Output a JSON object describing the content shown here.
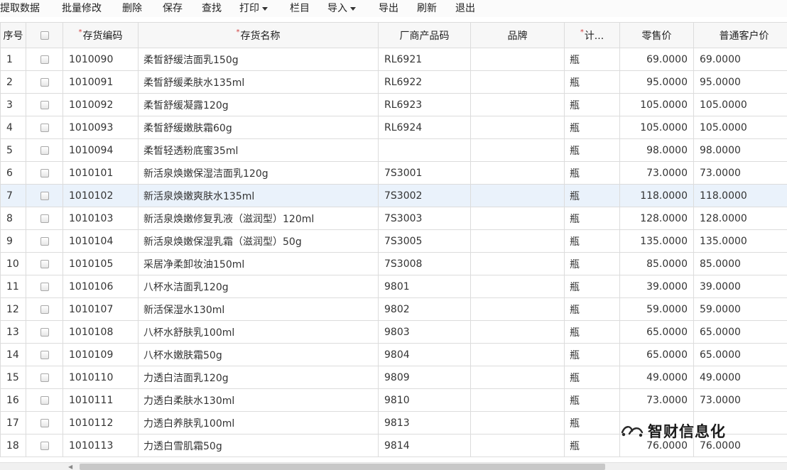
{
  "toolbar": {
    "items": [
      {
        "label": "提取数据",
        "dropdown": false
      },
      {
        "label": "批量修改",
        "dropdown": false
      },
      {
        "label": "删除",
        "dropdown": false
      },
      {
        "label": "保存",
        "dropdown": false
      },
      {
        "label": "查找",
        "dropdown": false
      },
      {
        "label": "打印",
        "dropdown": true
      },
      {
        "label": "栏目",
        "dropdown": false
      },
      {
        "label": "导入",
        "dropdown": true
      },
      {
        "label": "导出",
        "dropdown": false
      },
      {
        "label": "刷新",
        "dropdown": false
      },
      {
        "label": "退出",
        "dropdown": false
      }
    ]
  },
  "table": {
    "columns": {
      "seq": "序号",
      "code": "存货编码",
      "name": "存货名称",
      "mfr_code": "厂商产品码",
      "brand": "品牌",
      "unit": "计...",
      "retail_price": "零售价",
      "customer_price": "普通客户价"
    },
    "required_mark": "*",
    "rows": [
      {
        "seq": "1",
        "code": "1010090",
        "name": "柔皙舒缓洁面乳150g",
        "mfr_code": "RL6921",
        "brand": "",
        "unit": "瓶",
        "retail_price": "69.0000",
        "customer_price": "69.0000"
      },
      {
        "seq": "2",
        "code": "1010091",
        "name": "柔皙舒缓柔肤水135ml",
        "mfr_code": "RL6922",
        "brand": "",
        "unit": "瓶",
        "retail_price": "95.0000",
        "customer_price": "95.0000"
      },
      {
        "seq": "3",
        "code": "1010092",
        "name": "柔皙舒缓凝露120g",
        "mfr_code": "RL6923",
        "brand": "",
        "unit": "瓶",
        "retail_price": "105.0000",
        "customer_price": "105.0000"
      },
      {
        "seq": "4",
        "code": "1010093",
        "name": "柔皙舒缓嫩肤霜60g",
        "mfr_code": "RL6924",
        "brand": "",
        "unit": "瓶",
        "retail_price": "105.0000",
        "customer_price": "105.0000"
      },
      {
        "seq": "5",
        "code": "1010094",
        "name": "柔皙轻透粉底蜜35ml",
        "mfr_code": "",
        "brand": "",
        "unit": "瓶",
        "retail_price": "98.0000",
        "customer_price": "98.0000"
      },
      {
        "seq": "6",
        "code": "1010101",
        "name": "新活泉焕嫩保湿洁面乳120g",
        "mfr_code": "7S3001",
        "brand": "",
        "unit": "瓶",
        "retail_price": "73.0000",
        "customer_price": "73.0000"
      },
      {
        "seq": "7",
        "code": "1010102",
        "name": "新活泉焕嫩爽肤水135ml",
        "mfr_code": "7S3002",
        "brand": "",
        "unit": "瓶",
        "retail_price": "118.0000",
        "customer_price": "118.0000"
      },
      {
        "seq": "8",
        "code": "1010103",
        "name": "新活泉焕嫩修复乳液（滋润型）120ml",
        "mfr_code": "7S3003",
        "brand": "",
        "unit": "瓶",
        "retail_price": "128.0000",
        "customer_price": "128.0000"
      },
      {
        "seq": "9",
        "code": "1010104",
        "name": "新活泉焕嫩保湿乳霜（滋润型）50g",
        "mfr_code": "7S3005",
        "brand": "",
        "unit": "瓶",
        "retail_price": "135.0000",
        "customer_price": "135.0000"
      },
      {
        "seq": "10",
        "code": "1010105",
        "name": "采居净柔卸妆油150ml",
        "mfr_code": "7S3008",
        "brand": "",
        "unit": "瓶",
        "retail_price": "85.0000",
        "customer_price": "85.0000"
      },
      {
        "seq": "11",
        "code": "1010106",
        "name": "八杯水洁面乳120g",
        "mfr_code": "9801",
        "brand": "",
        "unit": "瓶",
        "retail_price": "39.0000",
        "customer_price": "39.0000"
      },
      {
        "seq": "12",
        "code": "1010107",
        "name": "新活保湿水130ml",
        "mfr_code": "9802",
        "brand": "",
        "unit": "瓶",
        "retail_price": "59.0000",
        "customer_price": "59.0000"
      },
      {
        "seq": "13",
        "code": "1010108",
        "name": "八杯水舒肤乳100ml",
        "mfr_code": "9803",
        "brand": "",
        "unit": "瓶",
        "retail_price": "65.0000",
        "customer_price": "65.0000"
      },
      {
        "seq": "14",
        "code": "1010109",
        "name": "八杯水嫩肤霜50g",
        "mfr_code": "9804",
        "brand": "",
        "unit": "瓶",
        "retail_price": "65.0000",
        "customer_price": "65.0000"
      },
      {
        "seq": "15",
        "code": "1010110",
        "name": "力透白洁面乳120g",
        "mfr_code": "9809",
        "brand": "",
        "unit": "瓶",
        "retail_price": "49.0000",
        "customer_price": "49.0000"
      },
      {
        "seq": "16",
        "code": "1010111",
        "name": "力透白柔肤水130ml",
        "mfr_code": "9810",
        "brand": "",
        "unit": "瓶",
        "retail_price": "73.0000",
        "customer_price": "73.0000"
      },
      {
        "seq": "17",
        "code": "1010112",
        "name": "力透白养肤乳100ml",
        "mfr_code": "9813",
        "brand": "",
        "unit": "瓶",
        "retail_price": "",
        "customer_price": ""
      },
      {
        "seq": "18",
        "code": "1010113",
        "name": "力透白雪肌霜50g",
        "mfr_code": "9814",
        "brand": "",
        "unit": "瓶",
        "retail_price": "76.0000",
        "customer_price": "76.0000"
      }
    ],
    "highlighted_row": "7"
  },
  "watermark": {
    "text": "智财信息化",
    "logo_icon": "wechat-official-account-icon"
  },
  "colors": {
    "grid_border": "#dcdcdc",
    "header_bg": "#f7f7f7",
    "highlight_row": "#eaf2fb",
    "required_mark": "#d04040"
  }
}
